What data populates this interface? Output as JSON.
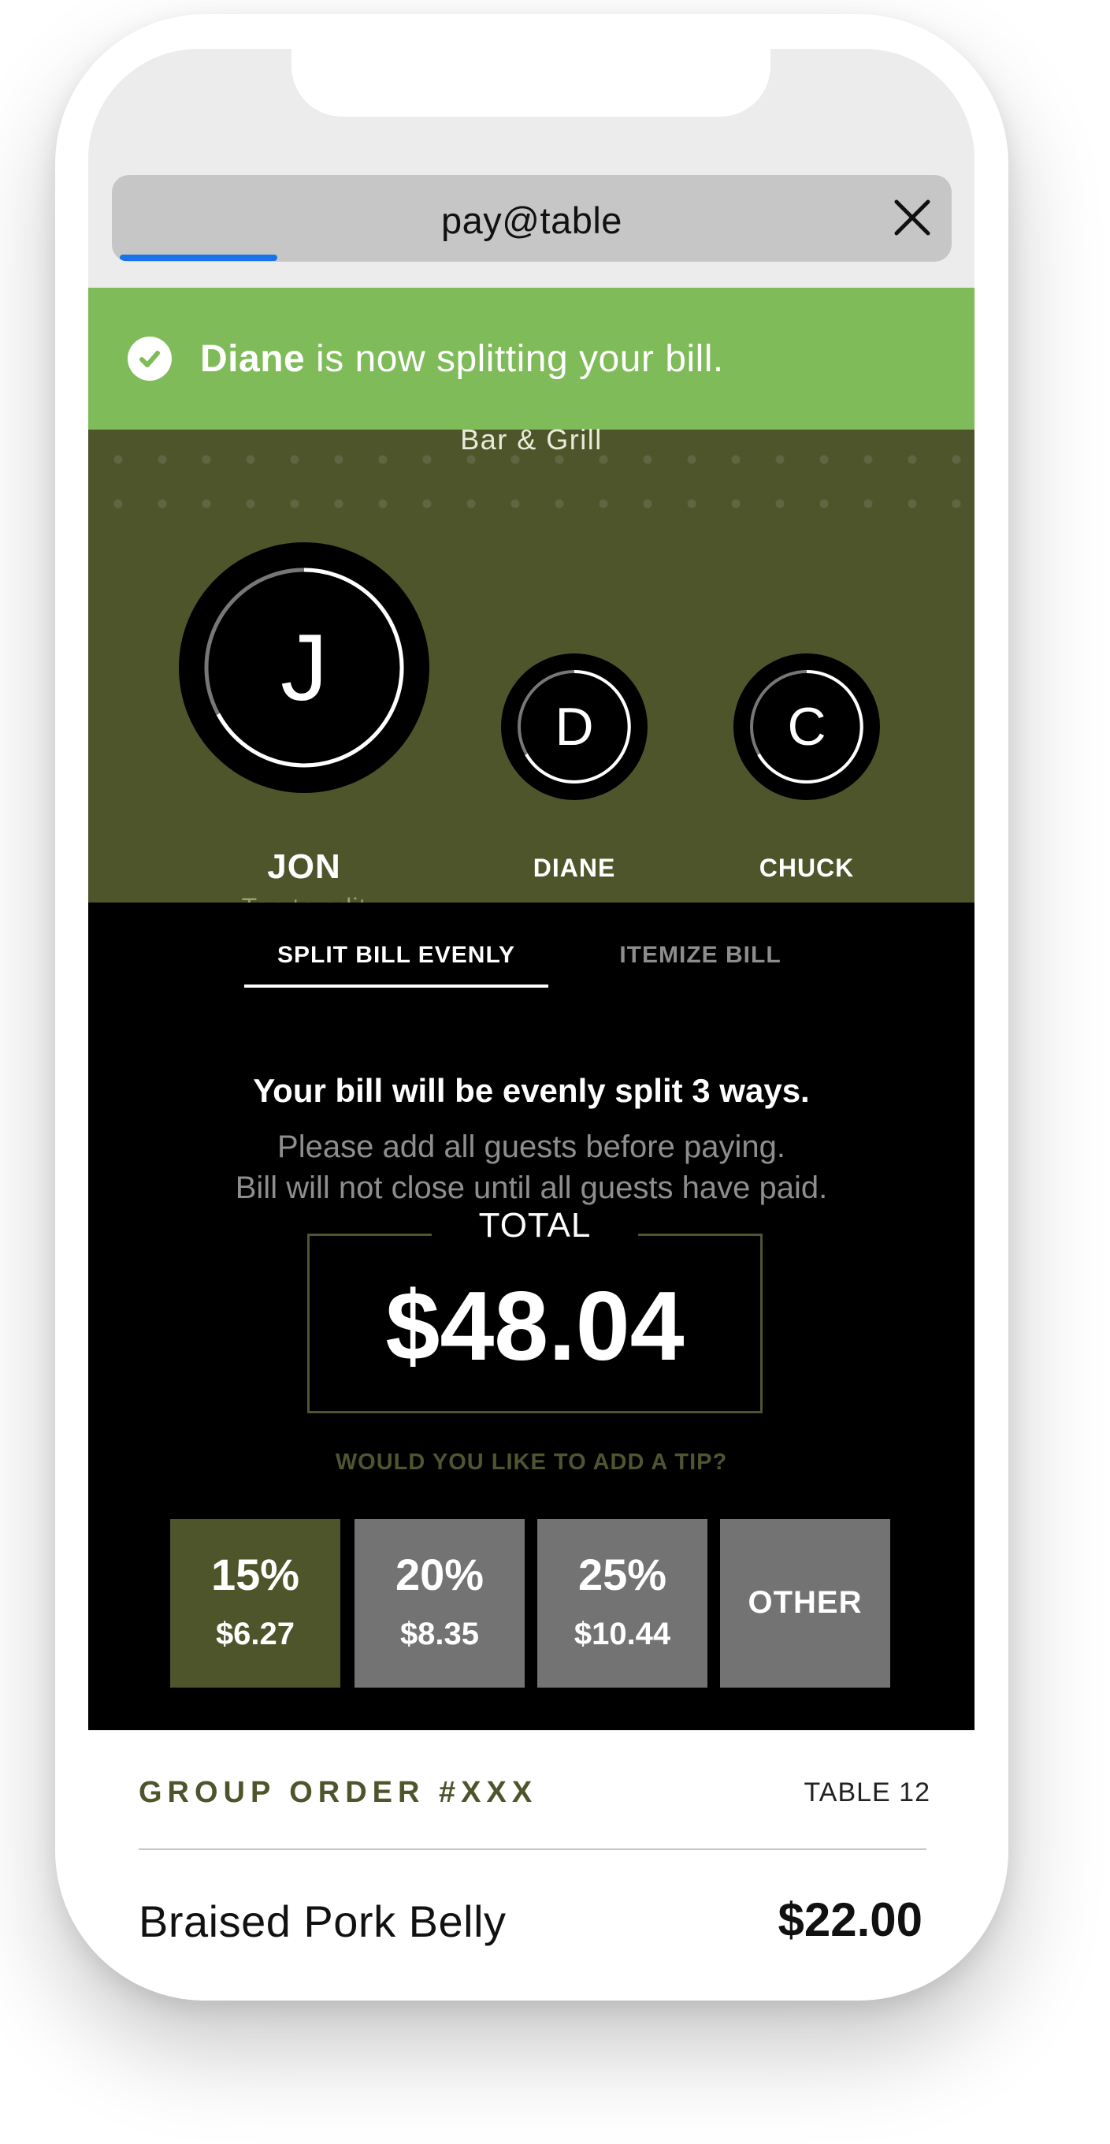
{
  "browser": {
    "url_title": "pay@table"
  },
  "notification": {
    "name": "Diane",
    "message": " is now splitting your bill."
  },
  "restaurant": {
    "subtitle": "Bar & Grill"
  },
  "guests": [
    {
      "initial": "J",
      "name": "JON",
      "hint": "Tap to edit"
    },
    {
      "initial": "D",
      "name": "DIANE"
    },
    {
      "initial": "C",
      "name": "CHUCK"
    }
  ],
  "tabs": [
    {
      "label": "SPLIT BILL EVENLY",
      "active": true
    },
    {
      "label": "ITEMIZE BILL",
      "active": false
    }
  ],
  "split": {
    "headline": "Your bill will be evenly split 3 ways.",
    "line1": "Please add all guests before paying.",
    "line2": "Bill will not close until all guests have paid."
  },
  "total": {
    "label": "TOTAL",
    "amount": "$48.04"
  },
  "tip": {
    "question": "WOULD YOU LIKE TO ADD A TIP?",
    "options": [
      {
        "pct": "15%",
        "amount": "$6.27",
        "selected": true
      },
      {
        "pct": "20%",
        "amount": "$8.35",
        "selected": false
      },
      {
        "pct": "25%",
        "amount": "$10.44",
        "selected": false
      },
      {
        "label": "OTHER",
        "selected": false
      }
    ]
  },
  "order": {
    "title": "GROUP ORDER #XXX",
    "table": "TABLE 12",
    "items": [
      {
        "name": "Braised Pork Belly",
        "price": "$22.00"
      }
    ]
  },
  "colors": {
    "notice_green": "#7fbb58",
    "olive": "#4e552b",
    "progress_blue": "#1a73e8",
    "tip_gray": "#737373"
  }
}
